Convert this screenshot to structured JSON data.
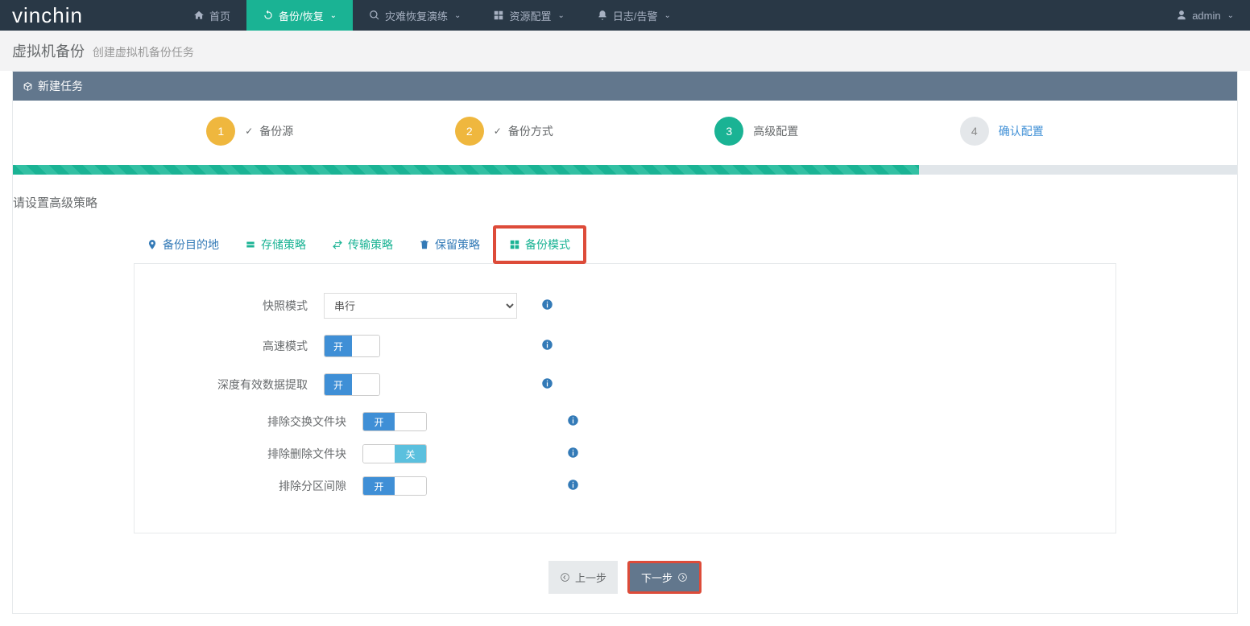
{
  "logo": "vinchin",
  "nav": {
    "home": "首页",
    "backup": "备份/恢复",
    "dr": "灾难恢复演练",
    "resource": "资源配置",
    "log": "日志/告警",
    "user": "admin"
  },
  "breadcrumb": {
    "main": "虚拟机备份",
    "sub": "创建虚拟机备份任务"
  },
  "card": {
    "title": "新建任务"
  },
  "steps": {
    "s1": "备份源",
    "s2": "备份方式",
    "s3": "高级配置",
    "s4": "确认配置"
  },
  "section_title": "请设置高级策略",
  "subtabs": {
    "dest": "备份目的地",
    "storage": "存储策略",
    "transfer": "传输策略",
    "retain": "保留策略",
    "mode": "备份模式"
  },
  "form": {
    "snapshot_label": "快照模式",
    "snapshot_value": "串行",
    "speed_label": "高速模式",
    "deep_label": "深度有效数据提取",
    "swap_label": "排除交换文件块",
    "deleted_label": "排除删除文件块",
    "partition_label": "排除分区间隙",
    "on": "开",
    "off": "关"
  },
  "buttons": {
    "prev": "上一步",
    "next": "下一步"
  }
}
